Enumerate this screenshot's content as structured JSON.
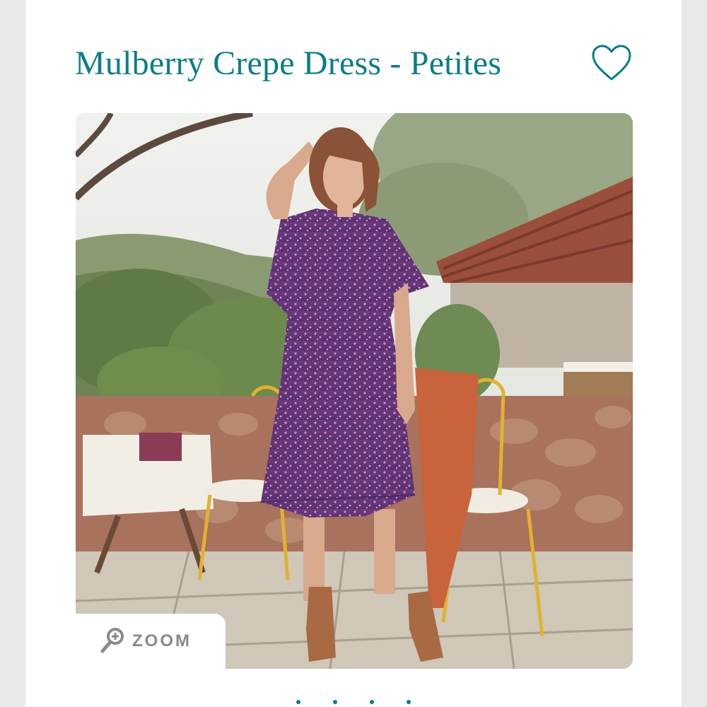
{
  "product": {
    "title": "Mulberry Crepe Dress - Petites",
    "image_alt": "Woman wearing a purple floral crepe dress in an outdoor patio setting"
  },
  "icons": {
    "favorite": "heart-outline-icon",
    "zoom": "magnifier-plus-icon"
  },
  "zoom": {
    "label": "ZOOM"
  },
  "colors": {
    "accent": "#0b7d8a",
    "zoom_text": "#8a8a8a",
    "background": "#ffffff"
  }
}
